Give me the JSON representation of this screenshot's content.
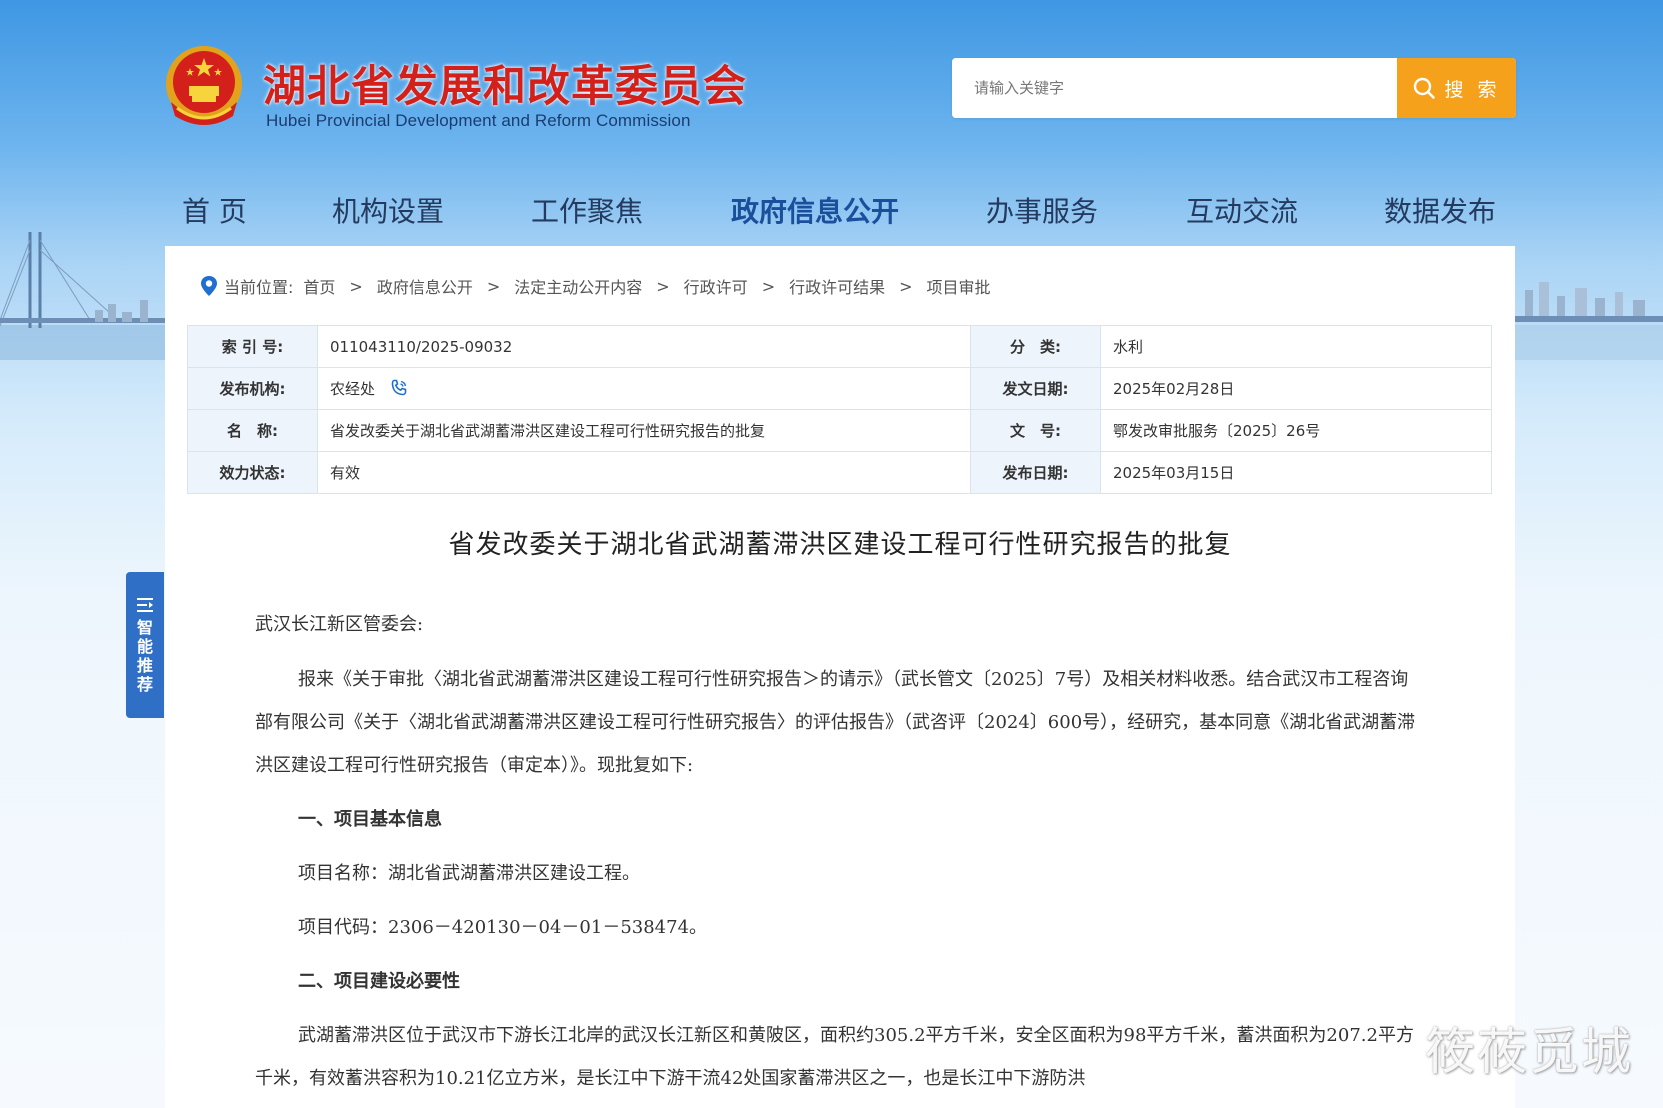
{
  "header": {
    "site_title_cn": "湖北省发展和改革委员会",
    "site_title_en": "Hubei Provincial Development and Reform Commission",
    "search_placeholder": "请输入关键字",
    "search_button_label": "搜 索"
  },
  "nav": {
    "items": [
      "首 页",
      "机构设置",
      "工作聚焦",
      "政府信息公开",
      "办事服务",
      "互动交流",
      "数据发布"
    ],
    "active": "政府信息公开"
  },
  "breadcrumb": {
    "prefix": "当前位置:",
    "items": [
      "首页",
      "政府信息公开",
      "法定主动公开内容",
      "行政许可",
      "行政许可结果",
      "项目审批"
    ],
    "separator": ">"
  },
  "info": {
    "index_label": "索 引 号:",
    "index_value": "011043110/2025-09032",
    "category_label": "分　类:",
    "category_value": "水利",
    "publisher_label": "发布机构:",
    "publisher_value": "农经处",
    "issue_date_label": "发文日期:",
    "issue_date_value": "2025年02月28日",
    "name_label": "名　称:",
    "name_value": "省发改委关于湖北省武湖蓄滞洪区建设工程可行性研究报告的批复",
    "doc_no_label": "文　号:",
    "doc_no_value": "鄂发改审批服务〔2025〕26号",
    "status_label": "效力状态:",
    "status_value": "有效",
    "publish_date_label": "发布日期:",
    "publish_date_value": "2025年03月15日"
  },
  "document": {
    "title": "省发改委关于湖北省武湖蓄滞洪区建设工程可行性研究报告的批复",
    "addressee": "武汉长江新区管委会:",
    "para1": "报来《关于审批〈湖北省武湖蓄滞洪区建设工程可行性研究报告＞的请示》（武长管文〔2025〕7号）及相关材料收悉。结合武汉市工程咨询部有限公司《关于〈湖北省武湖蓄滞洪区建设工程可行性研究报告〉的评估报告》（武咨评〔2024〕600号），经研究，基本同意《湖北省武湖蓄滞洪区建设工程可行性研究报告（审定本）》。现批复如下:",
    "section1": "一、项目基本信息",
    "project_name": "项目名称：湖北省武湖蓄滞洪区建设工程。",
    "project_code": "项目代码：2306－420130－04－01－538474。",
    "section2": "二、项目建设必要性",
    "para2": "武湖蓄滞洪区位于武汉市下游长江北岸的武汉长江新区和黄陂区，面积约305.2平方千米，安全区面积为98平方千米，蓄洪面积为207.2平方千米，有效蓄洪容积为10.21亿立方米，是长江中下游干流42处国家蓄滞洪区之一，也是长江中下游防洪"
  },
  "side_tab": {
    "label_chars": [
      "智",
      "能",
      "推",
      "荐"
    ]
  },
  "watermark": "筱莜觅城",
  "colors": {
    "title_red": "#d4201b",
    "nav_active": "#1a4f9c",
    "search_button": "#f6a11b",
    "side_tab": "#2f6fc5"
  }
}
